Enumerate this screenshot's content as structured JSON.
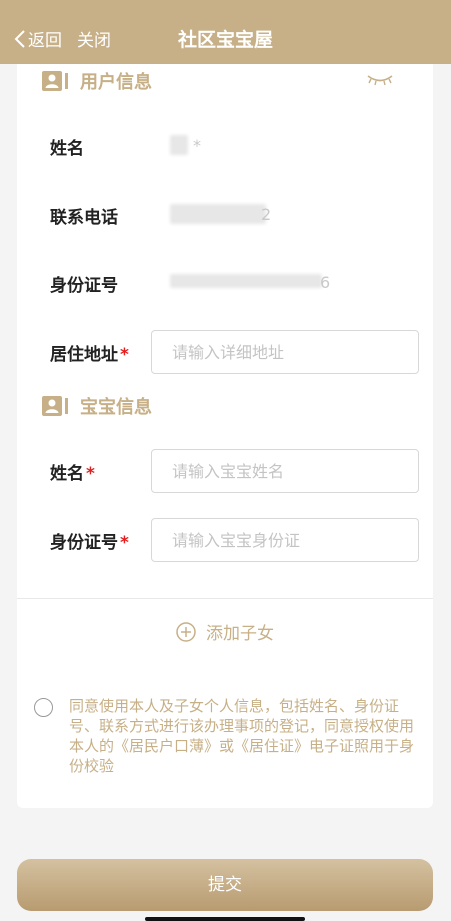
{
  "header": {
    "back_label": "返回",
    "close_label": "关闭",
    "title": "社区宝宝屋"
  },
  "user_info": {
    "section_title": "用户信息",
    "name_label": "姓名",
    "name_value": "*",
    "phone_label": "联系电话",
    "phone_value": "2",
    "id_label": "身份证号",
    "id_value": "6",
    "address_label": "居住地址",
    "address_required": "*",
    "address_placeholder": "请输入详细地址"
  },
  "baby_info": {
    "section_title": "宝宝信息",
    "name_label": "姓名",
    "name_required": "*",
    "name_placeholder": "请输入宝宝姓名",
    "id_label": "身份证号",
    "id_required": "*",
    "id_placeholder": "请输入宝宝身份证"
  },
  "add_child_label": "添加子女",
  "consent_text": "同意使用本人及子女个人信息，包括姓名、身份证号、联系方式进行该办理事项的登记，同意授权使用本人的《居民户口薄》或《居住证》电子证照用于身份校验",
  "submit_label": "提交",
  "colors": {
    "accent": "#c7b087",
    "required": "#e02020"
  }
}
